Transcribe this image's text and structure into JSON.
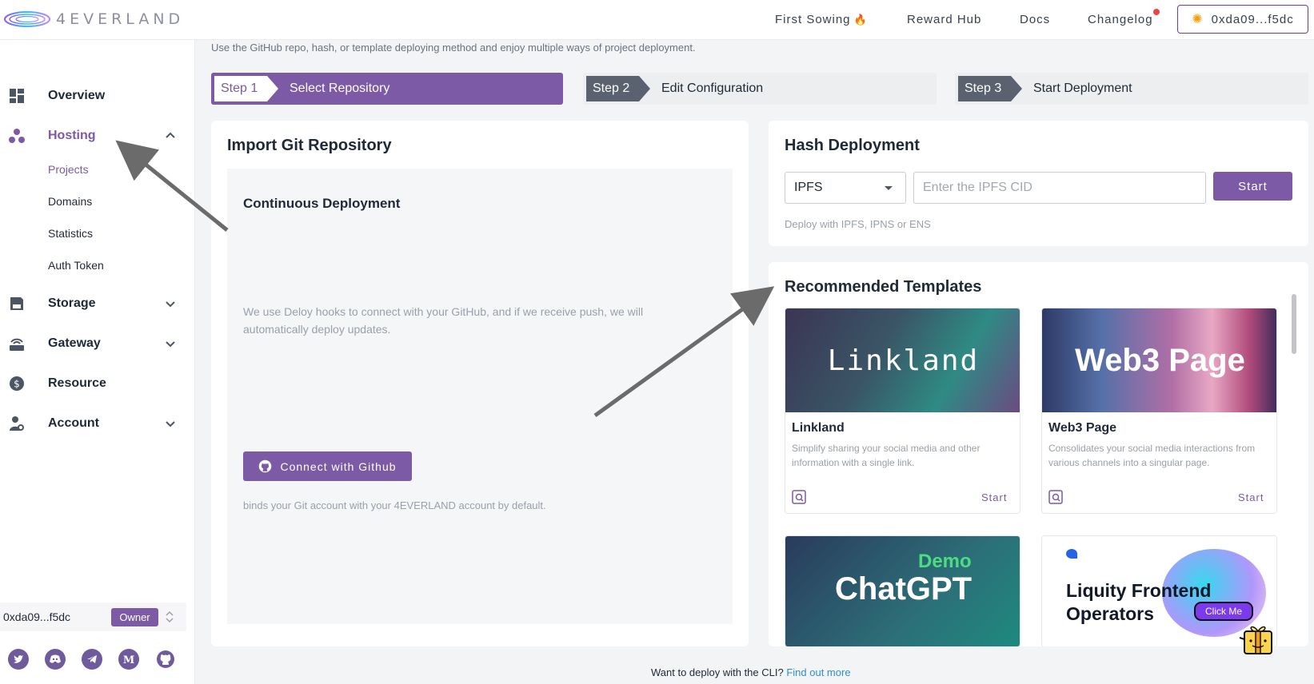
{
  "brand": {
    "name": "4EVERLAND"
  },
  "topnav": {
    "first_sowing": "First Sowing",
    "reward_hub": "Reward Hub",
    "docs": "Docs",
    "changelog": "Changelog",
    "wallet": "0xda09...f5dc"
  },
  "sidebar": {
    "overview": "Overview",
    "hosting": "Hosting",
    "hosting_items": [
      "Projects",
      "Domains",
      "Statistics",
      "Auth Token"
    ],
    "storage": "Storage",
    "gateway": "Gateway",
    "resource": "Resource",
    "account": "Account",
    "account_address": "0xda09...f5dc",
    "owner_badge": "Owner",
    "social_icons": [
      "twitter-icon",
      "discord-icon",
      "telegram-icon",
      "medium-icon",
      "github-icon"
    ]
  },
  "main": {
    "intro": "Use the GitHub repo, hash, or template deploying method and enjoy multiple ways of project deployment.",
    "steps": [
      {
        "tag": "Step 1",
        "label": "Select Repository"
      },
      {
        "tag": "Step 2",
        "label": "Edit Configuration"
      },
      {
        "tag": "Step 3",
        "label": "Start Deployment"
      }
    ],
    "import": {
      "title": "Import Git Repository",
      "cd_title": "Continuous Deployment",
      "cd_desc": "We use Deloy hooks to connect with your GitHub, and if we receive push, we will automatically deploy updates.",
      "button": "Connect with Github",
      "note": "binds your Git account with your 4EVERLAND account by default."
    },
    "hash": {
      "title": "Hash Deployment",
      "select_value": "IPFS",
      "input_placeholder": "Enter the IPFS CID",
      "start": "Start",
      "note": "Deploy with IPFS, IPNS or ENS"
    },
    "templates": {
      "title": "Recommended Templates",
      "items": [
        {
          "image_text": "Linkland",
          "name": "Linkland",
          "desc": "Simplify sharing your social media and other information with a single link.",
          "start": "Start"
        },
        {
          "image_text": "Web3 Page",
          "name": "Web3 Page",
          "desc": "Consolidates your social media interactions from various channels into a singular page.",
          "start": "Start"
        },
        {
          "image_text": "ChatGPT",
          "image_sub": "Demo"
        },
        {
          "image_text": "Liquity Frontend Operators",
          "image_cta": "Click Me"
        }
      ]
    },
    "cli": {
      "text": "Want to deploy with the CLI?",
      "link": "Find out more"
    }
  },
  "colors": {
    "accent": "#7c5aa6",
    "step_inactive": "#5a6270",
    "link": "#2b8fd6"
  }
}
